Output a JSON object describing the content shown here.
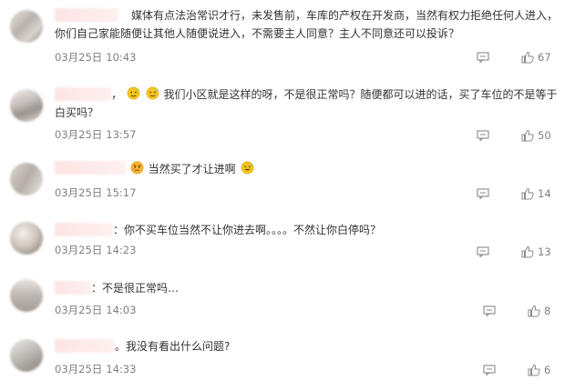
{
  "comments": [
    {
      "text": "媒体有点法治常识才行，未发售前，车库的产权在开发商，当然有权力拒绝任何人进入，你们自己家能随便让其他人随便说进入，不需要主人同意？主人不同意还可以投诉？",
      "date": "03月25日",
      "time": "10:43",
      "likes": "67"
    },
    {
      "prefix": "，",
      "text": "我们小区就是这样的呀，不是很正常吗？随便都可以进的话，买了车位的不是等于白买吗？",
      "date": "03月25日",
      "time": "13:57",
      "likes": "50"
    },
    {
      "text": "当然买了才让进啊",
      "date": "03月25日",
      "time": "15:17",
      "likes": "14"
    },
    {
      "prefix": "：",
      "text": "你不买车位当然不让你进去啊。。。。不然让你白停吗？",
      "date": "03月25日",
      "time": "14:23",
      "likes": "13"
    },
    {
      "prefix": "：",
      "text": "不是很正常吗…",
      "date": "03月25日",
      "time": "14:03",
      "likes": "8"
    },
    {
      "prefix": "。",
      "text": "我没有看出什么问题?",
      "date": "03月25日",
      "time": "14:33",
      "likes": "6"
    }
  ]
}
